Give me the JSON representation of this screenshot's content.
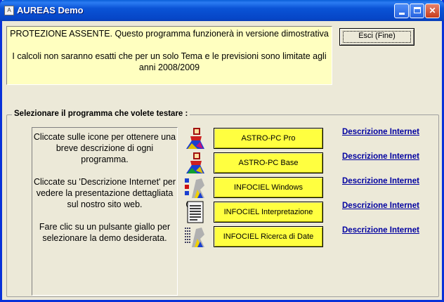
{
  "window": {
    "title": "AUREAS Demo",
    "app_icon": "app-icon"
  },
  "title_buttons": {
    "minimize": "minimize-icon",
    "maximize": "maximize-icon",
    "close": "✕"
  },
  "warning": {
    "line1": "PROTEZIONE ASSENTE. Questo programma funzionerà in versione dimostrativa",
    "line2": "I calcoli non saranno esatti che per un solo Tema e le previsioni sono limitate agli anni 2008/2009",
    "background": "#ffffc0"
  },
  "exit_label": "Esci (Fine)",
  "group_label": "Selezionare il programma che volete testare :",
  "info": {
    "p1": "Cliccate sulle icone per ottenere una breve descrizione di ogni programma.",
    "p2": "Cliccate su 'Descrizione Internet' per vedere la presentazione dettagliata sul nostro sito web.",
    "p3": "Fare clic su un pulsante giallo per selezionare la demo desiderata."
  },
  "programs": [
    {
      "icon": "astro-pc-pro-icon",
      "label": "ASTRO-PC Pro",
      "link": "Descrizione Internet"
    },
    {
      "icon": "astro-pc-base-icon",
      "label": "ASTRO-PC Base",
      "link": "Descrizione Internet"
    },
    {
      "icon": "infociel-windows-icon",
      "label": "INFOCIEL Windows",
      "link": "Descrizione Internet"
    },
    {
      "icon": "infociel-interpretazione-icon",
      "label": "INFOCIEL Interpretazione",
      "link": "Descrizione Internet"
    },
    {
      "icon": "infociel-ricerca-icon",
      "label": "INFOCIEL Ricerca di Date",
      "link": "Descrizione Internet"
    }
  ],
  "colors": {
    "button_yellow": "#ffff40",
    "link": "#0000a0",
    "titlebar": "#0a53d6"
  }
}
